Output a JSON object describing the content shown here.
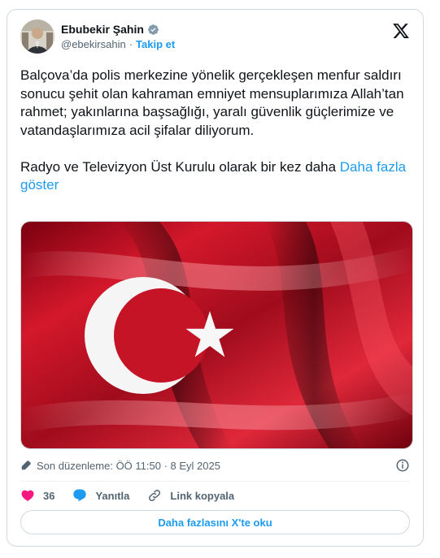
{
  "author": {
    "name": "Ebubekir Şahin",
    "handle": "@ebekirsahin",
    "separator": "·",
    "follow_label": "Takip et"
  },
  "tweet": {
    "text": "Balçova’da polis merkezine yönelik gerçekleşen menfur saldırı sonucu şehit olan kahraman emniyet mensuplarımıza Allah’tan rahmet; yakınlarına başsağlığı, yaralı güvenlik güçlerimize ve vatandaşlarımıza acil şifalar diliyorum.\n\nRadyo ve Televizyon Üst Kurulu olarak bir kez daha ",
    "show_more": "Daha fazla göster"
  },
  "meta": {
    "edited_label": "Son düzenleme: ÖÖ 11:50 · 8 Eyl 2025"
  },
  "actions": {
    "likes": "36",
    "reply_label": "Yanıtla",
    "copy_link_label": "Link kopyala"
  },
  "read_more_label": "Daha fazlasını X'te oku",
  "colors": {
    "accent": "#1d9bf0",
    "like": "#f91880",
    "text": "#0f1419",
    "muted": "#536471",
    "border": "#cfd9de",
    "flag_red": "#c8102e"
  },
  "icons": [
    "verified-badge-icon",
    "x-logo-icon",
    "edit-pencil-icon",
    "info-icon",
    "heart-icon",
    "reply-bubble-icon",
    "link-icon"
  ]
}
